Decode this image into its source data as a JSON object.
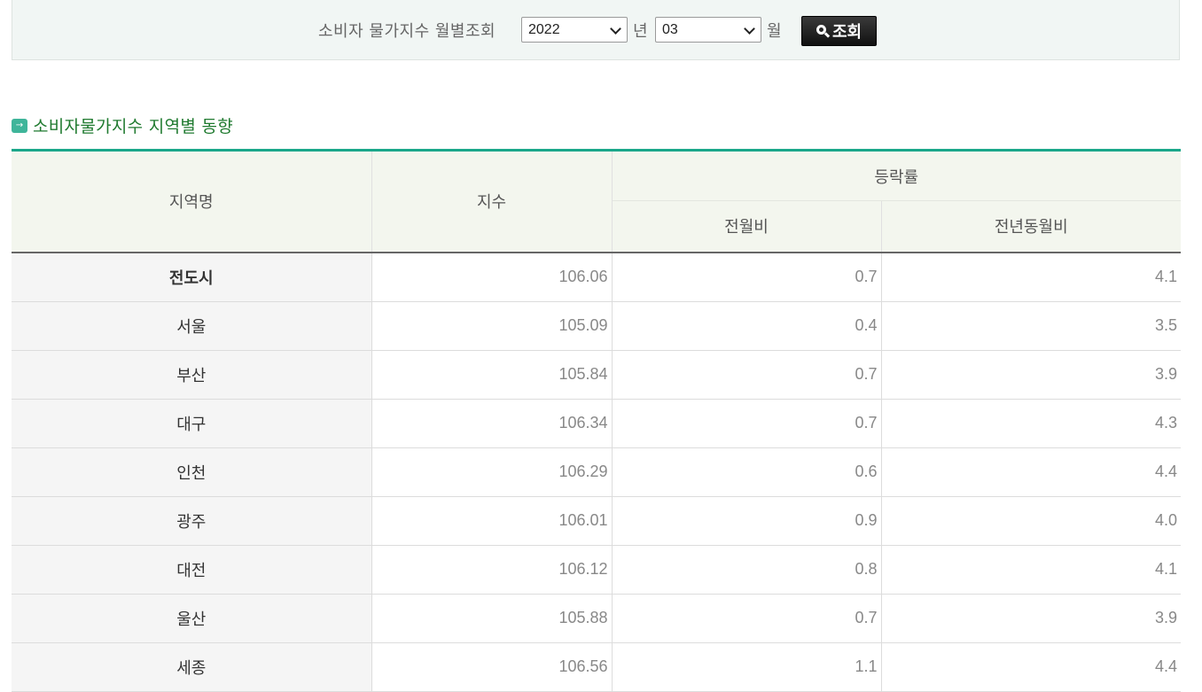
{
  "search": {
    "label": "소비자 물가지수 월별조회",
    "year_value": "2022",
    "year_unit": "년",
    "month_value": "03",
    "month_unit": "월",
    "button_label": "조회"
  },
  "section": {
    "title": "소비자물가지수 지역별 동향",
    "icon": "arrow-right-icon"
  },
  "table": {
    "headers": {
      "region": "지역명",
      "index": "지수",
      "change": "등락률",
      "mom": "전월비",
      "yoy": "전년동월비"
    },
    "rows": [
      {
        "region": "전도시",
        "index": "106.06",
        "mom": "0.7",
        "yoy": "4.1"
      },
      {
        "region": "서울",
        "index": "105.09",
        "mom": "0.4",
        "yoy": "3.5"
      },
      {
        "region": "부산",
        "index": "105.84",
        "mom": "0.7",
        "yoy": "3.9"
      },
      {
        "region": "대구",
        "index": "106.34",
        "mom": "0.7",
        "yoy": "4.3"
      },
      {
        "region": "인천",
        "index": "106.29",
        "mom": "0.6",
        "yoy": "4.4"
      },
      {
        "region": "광주",
        "index": "106.01",
        "mom": "0.9",
        "yoy": "4.0"
      },
      {
        "region": "대전",
        "index": "106.12",
        "mom": "0.8",
        "yoy": "4.1"
      },
      {
        "region": "울산",
        "index": "105.88",
        "mom": "0.7",
        "yoy": "3.9"
      },
      {
        "region": "세종",
        "index": "106.56",
        "mom": "1.1",
        "yoy": "4.4"
      }
    ]
  },
  "colors": {
    "accent": "#1aa78a",
    "title_text": "#1f7a2f",
    "header_bg": "#f3f6ee",
    "search_bg": "#f1f6f4"
  }
}
